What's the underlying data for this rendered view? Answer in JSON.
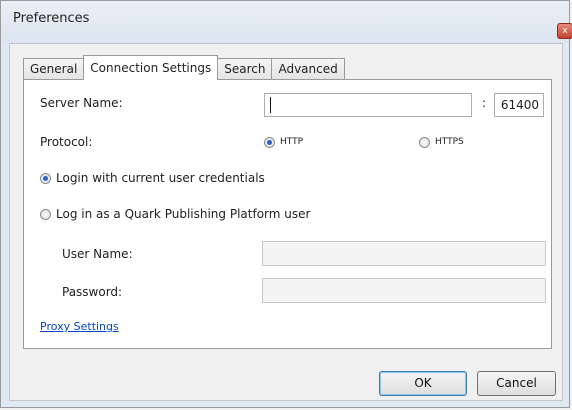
{
  "window": {
    "title": "Preferences",
    "close_glyph": "x"
  },
  "tabs": [
    {
      "label": "General"
    },
    {
      "label": "Connection Settings",
      "active": true
    },
    {
      "label": "Search"
    },
    {
      "label": "Advanced"
    }
  ],
  "form": {
    "server_name_label": "Server Name:",
    "server_name_value": "",
    "port_separator": ":",
    "port_value": "61400",
    "protocol_label": "Protocol:",
    "protocol_http": "HTTP",
    "protocol_https": "HTTPS",
    "protocol_selected": "HTTP",
    "login_current_label": "Login with current user credentials",
    "login_quark_label": "Log in as a Quark Publishing Platform user",
    "login_selected": "current",
    "user_name_label": "User Name:",
    "user_name_value": "",
    "password_label": "Password:",
    "password_value": "",
    "proxy_settings_link": "Proxy Settings"
  },
  "buttons": {
    "ok": "OK",
    "cancel": "Cancel"
  },
  "colors": {
    "titlebar": "#dfe9f5",
    "link": "#0645c6",
    "radio_selected": "#2a62c8"
  }
}
